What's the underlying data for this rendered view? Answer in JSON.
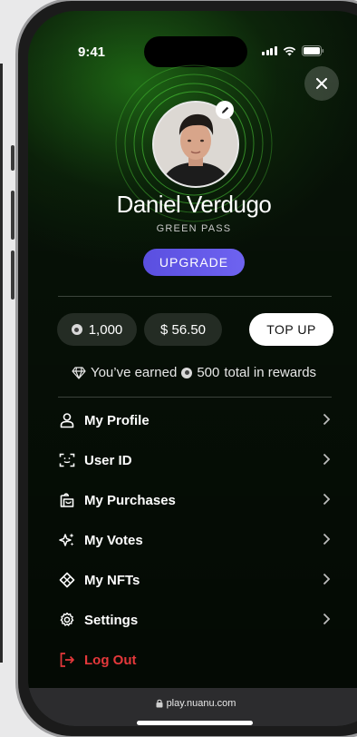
{
  "status_bar": {
    "time": "9:41"
  },
  "profile": {
    "name": "Daniel Verdugo",
    "tier": "GREEN PASS",
    "upgrade_label": "UPGRADE"
  },
  "wallet": {
    "coins": "1,000",
    "balance": "$ 56.50",
    "topup_label": "TOP UP"
  },
  "rewards": {
    "prefix": "You’ve earned",
    "amount": "500",
    "suffix": "total in rewards"
  },
  "menu": {
    "items": [
      {
        "label": "My Profile",
        "icon": "user-icon"
      },
      {
        "label": "User ID",
        "icon": "scan-id-icon"
      },
      {
        "label": "My Purchases",
        "icon": "purchases-bag-icon"
      },
      {
        "label": "My Votes",
        "icon": "sparkles-icon"
      },
      {
        "label": "My NFTs",
        "icon": "nft-diamond-icon"
      },
      {
        "label": "Settings",
        "icon": "gear-icon"
      }
    ],
    "logout_label": "Log Out"
  },
  "browser": {
    "url": "play.nuanu.com"
  },
  "colors": {
    "accent_purple": "#5a4fe0",
    "logout_red": "#e5383b",
    "background_green": "#14400f"
  }
}
